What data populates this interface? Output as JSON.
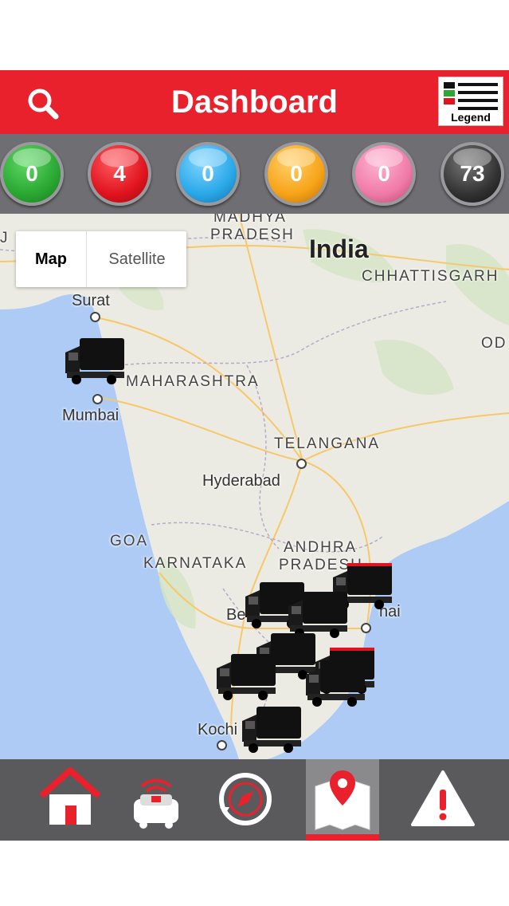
{
  "header": {
    "title": "Dashboard",
    "legend_label": "Legend",
    "search_icon": "search-icon",
    "legend_icon": "legend-list-icon"
  },
  "status_counts": [
    {
      "value": "0",
      "color": "#2aa832"
    },
    {
      "value": "4",
      "color": "#e0141e"
    },
    {
      "value": "0",
      "color": "#2aa8e8"
    },
    {
      "value": "0",
      "color": "#f7a318"
    },
    {
      "value": "0",
      "color": "#f07aa8"
    },
    {
      "value": "73",
      "color": "#333333"
    }
  ],
  "map": {
    "type_control": {
      "map_label": "Map",
      "satellite_label": "Satellite",
      "selected": "Map"
    },
    "country": "India",
    "states": [
      "MADHYA",
      "PRADESH",
      "CHHATTISGARH",
      "MAHARASHTRA",
      "TELANGANA",
      "GOA",
      "KARNATAKA",
      "ANDHRA",
      "PRADESH",
      "OD",
      "J"
    ],
    "cities": [
      "Surat",
      "Mumbai",
      "Hyderabad",
      "Be",
      "nai",
      "Kochi"
    ],
    "marker_icon": "truck-icon"
  },
  "bottom_nav": [
    {
      "name": "home",
      "icon": "home-icon"
    },
    {
      "name": "live-tracking",
      "icon": "car-signal-icon"
    },
    {
      "name": "history",
      "icon": "compass-history-icon"
    },
    {
      "name": "map",
      "icon": "map-pin-icon",
      "active": true
    },
    {
      "name": "alerts",
      "icon": "warning-icon"
    }
  ],
  "colors": {
    "brand": "#e8212d",
    "status_bar": "#6f6f73",
    "nav_bg": "#5a5a5c"
  }
}
